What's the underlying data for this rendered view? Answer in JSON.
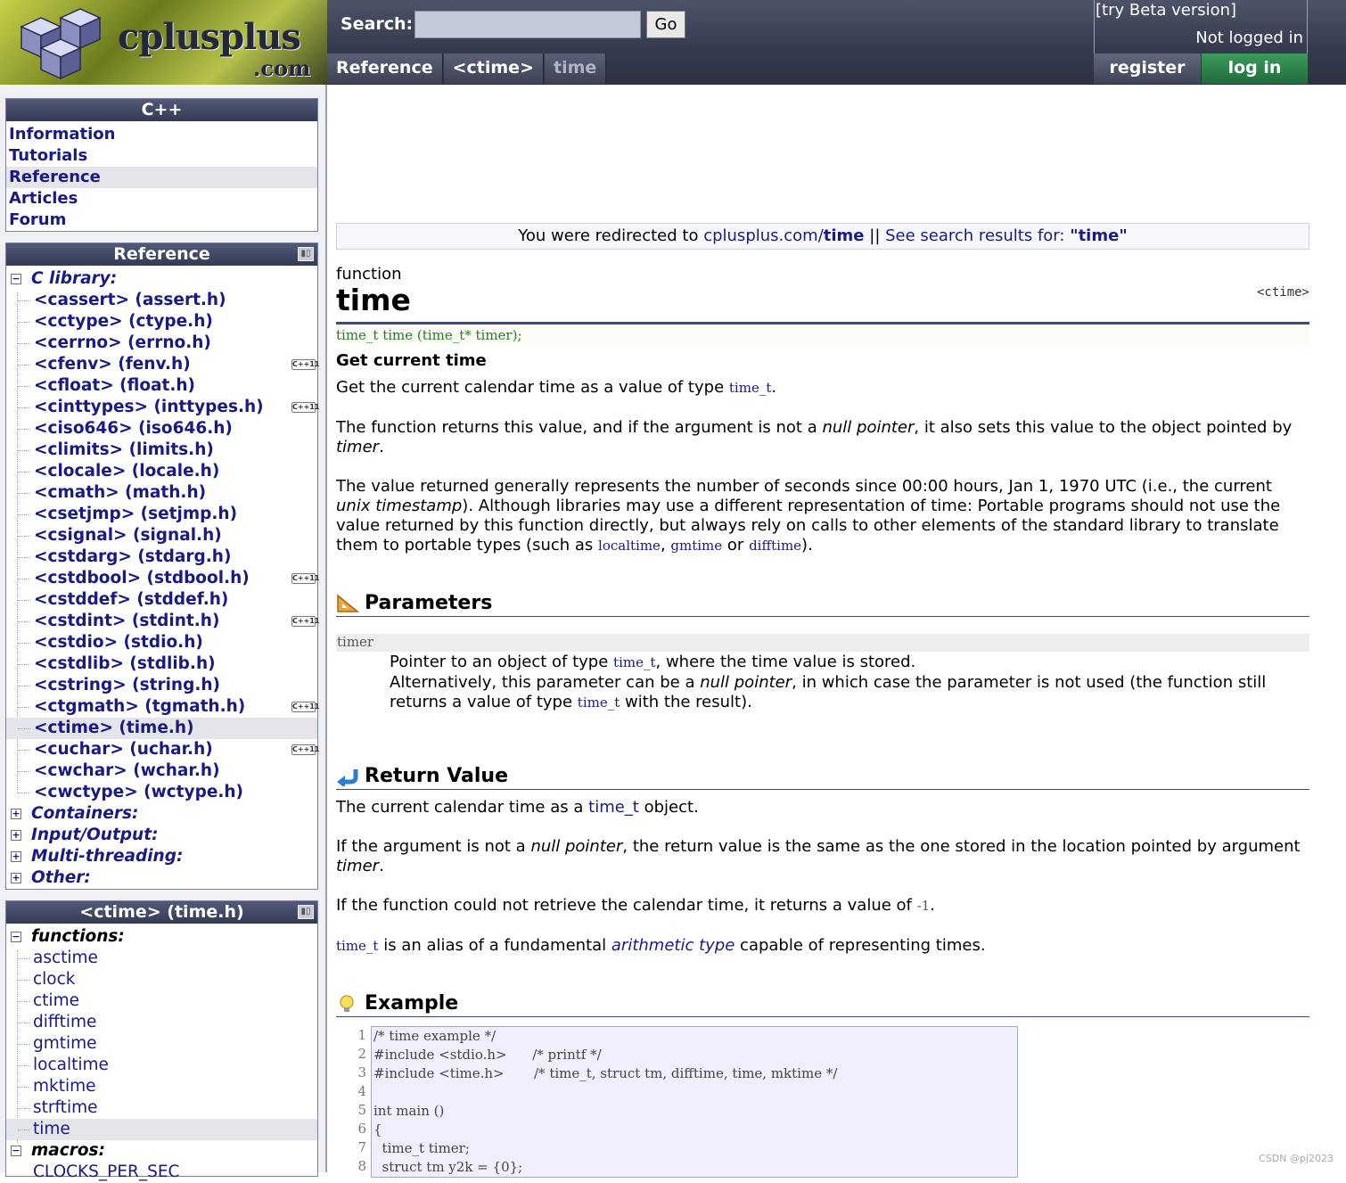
{
  "header": {
    "logo_text": "cplusplus",
    "logo_domain": ".com",
    "search_label": "Search:",
    "search_value": "",
    "go_label": "Go",
    "beta_link": "[try Beta version]",
    "login_status": "Not logged in",
    "register_label": "register",
    "login_label": "log in",
    "breadcrumbs": [
      "Reference",
      "<ctime>",
      "time"
    ]
  },
  "sidebar": {
    "cpp_box": {
      "title": "C++",
      "items": [
        "Information",
        "Tutorials",
        "Reference",
        "Articles",
        "Forum"
      ],
      "selected": "Reference"
    },
    "reference_box": {
      "title": "Reference",
      "c_library_label": "C library:",
      "headers": [
        {
          "label": "<cassert> (assert.h)",
          "cpp11": false
        },
        {
          "label": "<cctype> (ctype.h)",
          "cpp11": false
        },
        {
          "label": "<cerrno> (errno.h)",
          "cpp11": false
        },
        {
          "label": "<cfenv> (fenv.h)",
          "cpp11": true
        },
        {
          "label": "<cfloat> (float.h)",
          "cpp11": false
        },
        {
          "label": "<cinttypes> (inttypes.h)",
          "cpp11": true
        },
        {
          "label": "<ciso646> (iso646.h)",
          "cpp11": false
        },
        {
          "label": "<climits> (limits.h)",
          "cpp11": false
        },
        {
          "label": "<clocale> (locale.h)",
          "cpp11": false
        },
        {
          "label": "<cmath> (math.h)",
          "cpp11": false
        },
        {
          "label": "<csetjmp> (setjmp.h)",
          "cpp11": false
        },
        {
          "label": "<csignal> (signal.h)",
          "cpp11": false
        },
        {
          "label": "<cstdarg> (stdarg.h)",
          "cpp11": false
        },
        {
          "label": "<cstdbool> (stdbool.h)",
          "cpp11": true
        },
        {
          "label": "<cstddef> (stddef.h)",
          "cpp11": false
        },
        {
          "label": "<cstdint> (stdint.h)",
          "cpp11": true
        },
        {
          "label": "<cstdio> (stdio.h)",
          "cpp11": false
        },
        {
          "label": "<cstdlib> (stdlib.h)",
          "cpp11": false
        },
        {
          "label": "<cstring> (string.h)",
          "cpp11": false
        },
        {
          "label": "<ctgmath> (tgmath.h)",
          "cpp11": true
        },
        {
          "label": "<ctime> (time.h)",
          "cpp11": false,
          "selected": true
        },
        {
          "label": "<cuchar> (uchar.h)",
          "cpp11": true
        },
        {
          "label": "<cwchar> (wchar.h)",
          "cpp11": false
        },
        {
          "label": "<cwctype> (wctype.h)",
          "cpp11": false
        }
      ],
      "collapsed_categories": [
        "Containers:",
        "Input/Output:",
        "Multi-threading:",
        "Other:"
      ],
      "cpp11_badge": "C++11"
    },
    "ctime_box": {
      "title": "<ctime> (time.h)",
      "functions_label": "functions:",
      "functions": [
        "asctime",
        "clock",
        "ctime",
        "difftime",
        "gmtime",
        "localtime",
        "mktime",
        "strftime",
        "time"
      ],
      "selected": "time",
      "macros_label": "macros:",
      "macros": [
        "CLOCKS_PER_SEC"
      ]
    }
  },
  "main": {
    "redirect": {
      "prefix": "You were redirected to",
      "site": "cplusplus.com/",
      "page": "time",
      "separator": "||",
      "search_text": "See search results for:",
      "search_term": "\"time\""
    },
    "kind": "function",
    "title": "time",
    "header_tag": "<ctime>",
    "prototype": "time_t time (time_t* timer);",
    "summary": "Get current time",
    "description": {
      "p1_text": "Get the current calendar time as a value of type",
      "p1_code": "time_t",
      "p2_a": "The function returns this value, and if the argument is not a",
      "p2_em": "null pointer",
      "p2_b": ", it also sets this value to the object pointed by",
      "p2_em2": "timer",
      "p3_a": "The value returned generally represents the number of seconds since 00:00 hours, Jan 1, 1970 UTC (i.e., the current",
      "p3_em": "unix timestamp",
      "p3_b": "). Although libraries may use a different representation of time: Portable programs should not use the value returned by this function directly, but always rely on calls to other elements of the standard library to translate them to portable types (such as",
      "p3_code1": "localtime",
      "p3_code2": "gmtime",
      "p3_or": "or",
      "p3_code3": "difftime"
    },
    "parameters": {
      "heading": "Parameters",
      "name": "timer",
      "d1_a": "Pointer to an object of type",
      "d1_code": "time_t",
      "d1_b": ", where the time value is stored.",
      "d2_a": "Alternatively, this parameter can be a",
      "d2_em": "null pointer",
      "d2_b": ", in which case the parameter is not used (the function still returns a value of type",
      "d2_code": "time_t",
      "d2_c": "with the result)."
    },
    "return_value": {
      "heading": "Return Value",
      "r1_a": "The current calendar time as a",
      "r1_link": "time_t",
      "r1_b": "object.",
      "r2_a": "If the argument is not a",
      "r2_em": "null pointer",
      "r2_b": ", the return value is the same as the one stored in the location pointed by argument",
      "r2_em2": "timer",
      "r3_a": "If the function could not retrieve the calendar time, it returns a value of",
      "r3_code": "-1",
      "r4_code": "time_t",
      "r4_a": "is an alias of a fundamental",
      "r4_em": "arithmetic type",
      "r4_b": "capable of representing times."
    },
    "example": {
      "heading": "Example",
      "line_numbers": [
        "1",
        "2",
        "3",
        "4",
        "5",
        "6",
        "7",
        "8"
      ],
      "lines": [
        "/* time example */",
        "#include <stdio.h>      /* printf */",
        "#include <time.h>       /* time_t, struct tm, difftime, time, mktime */",
        "",
        "int main ()",
        "{",
        "  time_t timer;",
        "  struct tm y2k = {0};"
      ]
    }
  },
  "watermark": "CSDN @pj2023"
}
